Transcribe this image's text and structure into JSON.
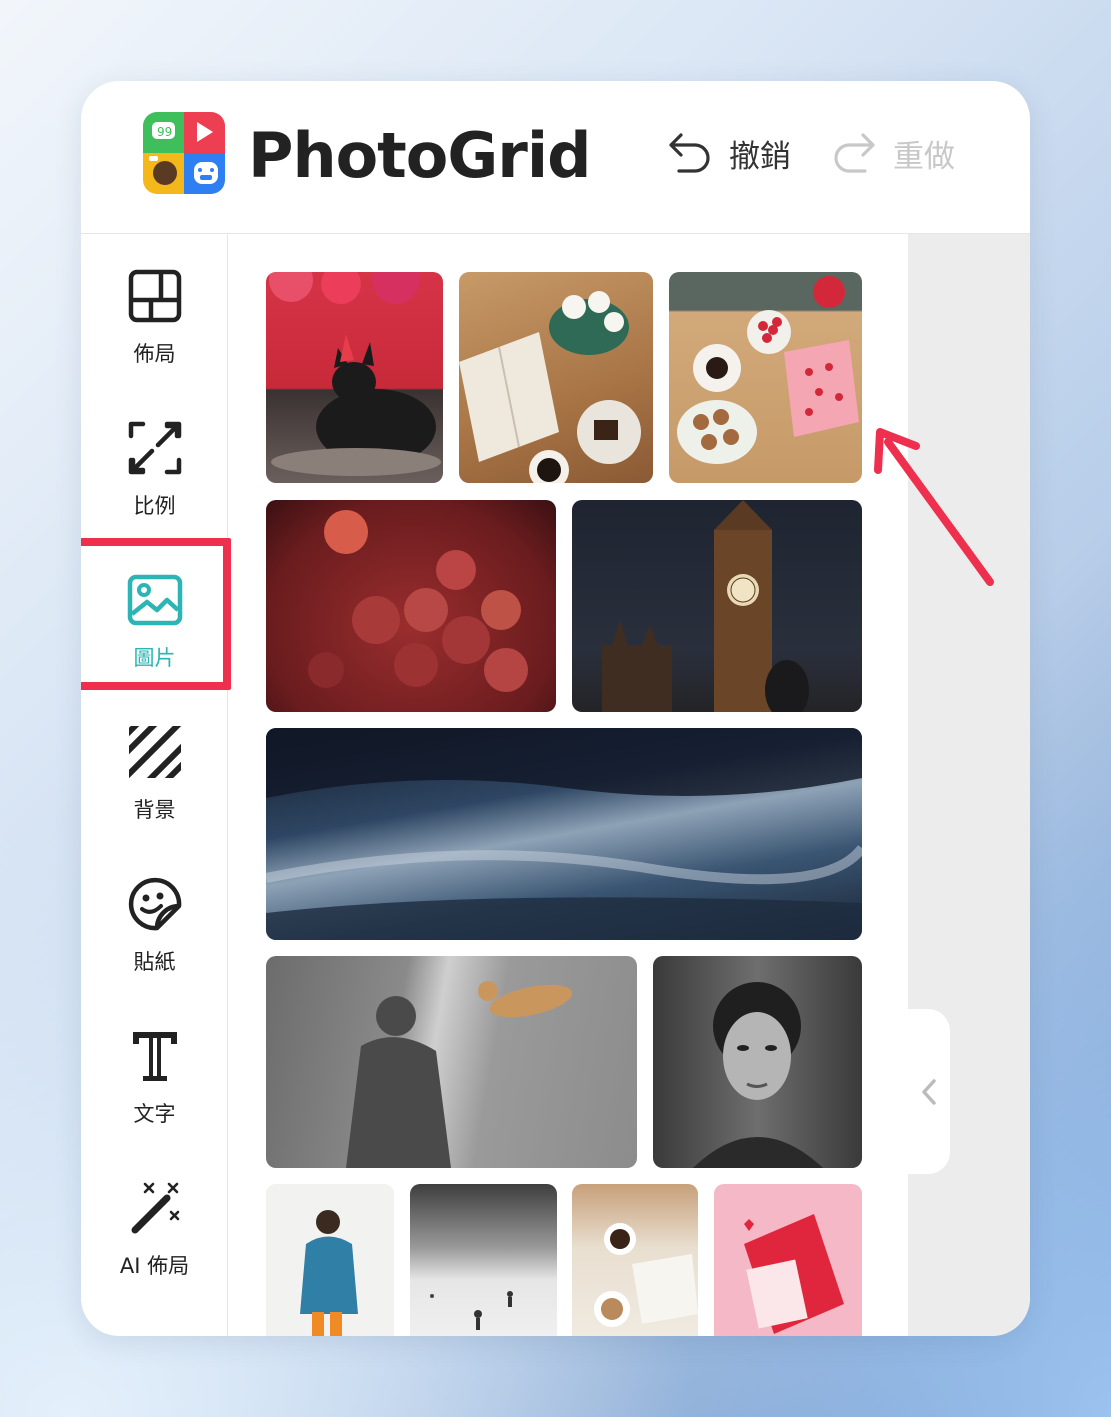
{
  "app": {
    "brand_name": "PhotoGrid",
    "logo_icon": "photogrid-logo-icon"
  },
  "toolbar": {
    "undo_label": "撤銷",
    "redo_label": "重做",
    "undo_icon": "undo-arrow-icon",
    "redo_icon": "redo-arrow-icon"
  },
  "sidebar": {
    "items": [
      {
        "label": "佈局",
        "icon": "layout-grid-icon",
        "active": false
      },
      {
        "label": "比例",
        "icon": "aspect-ratio-icon",
        "active": false
      },
      {
        "label": "圖片",
        "icon": "image-icon",
        "active": true
      },
      {
        "label": "背景",
        "icon": "stripes-background-icon",
        "active": false
      },
      {
        "label": "貼紙",
        "icon": "sticker-face-icon",
        "active": false
      },
      {
        "label": "文字",
        "icon": "text-t-icon",
        "active": false
      },
      {
        "label": "AI 佈局",
        "icon": "magic-wand-icon",
        "active": false
      }
    ],
    "highlighted_item": "圖片"
  },
  "photos": [
    {
      "name": "black-cat-party-hat",
      "colors": [
        "#d9323f",
        "#1a1a1a"
      ]
    },
    {
      "name": "book-coffee-flowers",
      "colors": [
        "#b07a4a",
        "#e8e2d6"
      ]
    },
    {
      "name": "strawberries-cookies",
      "colors": [
        "#cfa574",
        "#e88a9a"
      ]
    },
    {
      "name": "grapes-in-water",
      "colors": [
        "#7a1f22",
        "#c45a4a"
      ]
    },
    {
      "name": "big-ben-night",
      "colors": [
        "#2b2f3a",
        "#8a5a32"
      ]
    },
    {
      "name": "snowy-landscape",
      "colors": [
        "#24364f",
        "#a9b8c8"
      ]
    },
    {
      "name": "shadow-and-dog",
      "colors": [
        "#8a8a8a",
        "#c9a06a"
      ]
    },
    {
      "name": "bw-portrait-woman",
      "colors": [
        "#2a2a2a",
        "#9a9a9a"
      ]
    },
    {
      "name": "woman-blue-coat",
      "colors": [
        "#f2f2f2",
        "#2f7fa6"
      ]
    },
    {
      "name": "skiers-bw",
      "colors": [
        "#cfcfcf",
        "#5a5a5a"
      ]
    },
    {
      "name": "coffee-newspaper",
      "colors": [
        "#d7c3a6",
        "#f0ece4"
      ]
    },
    {
      "name": "love-letter-pink",
      "colors": [
        "#f3b3c3",
        "#e0263c"
      ]
    }
  ],
  "accent_colors": {
    "active": "#2bb5b5",
    "highlight": "#ee2f4d"
  }
}
